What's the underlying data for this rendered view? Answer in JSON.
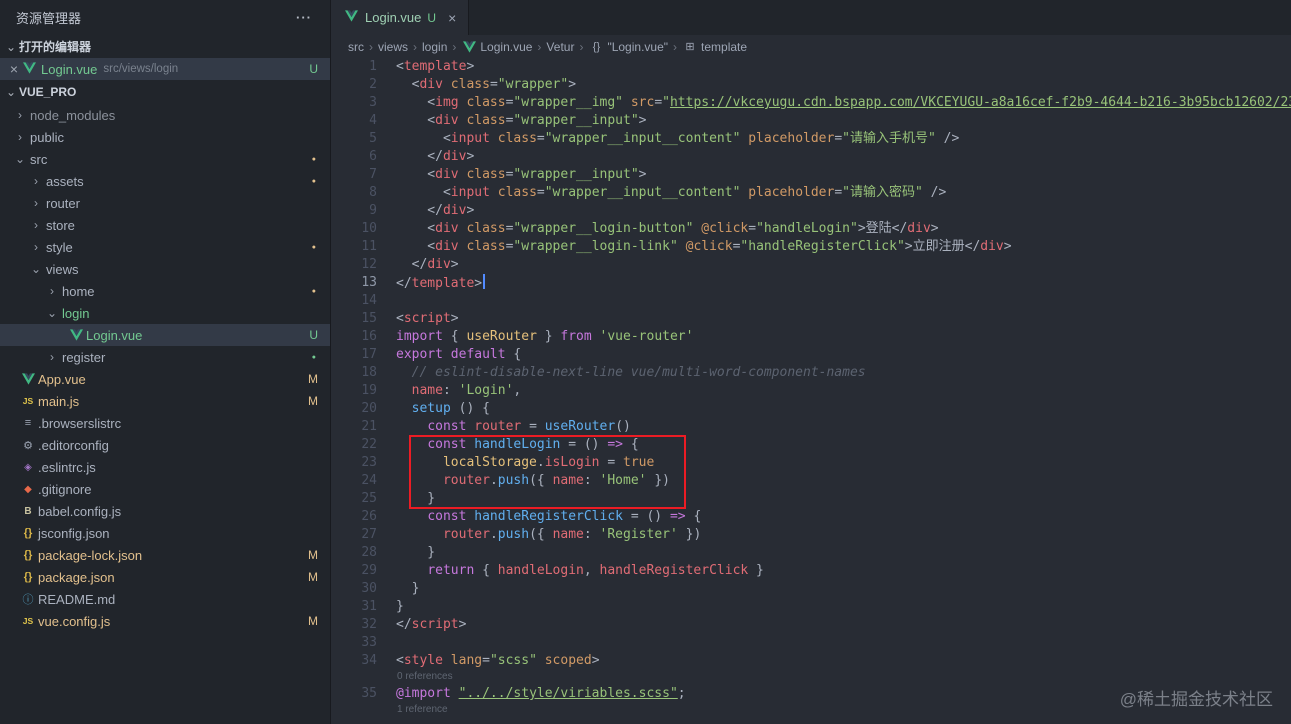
{
  "icons": {
    "ellipsis": "···",
    "chev_open": "⌄",
    "chev_closed": "›",
    "close": "×",
    "vue": "vue-logo",
    "js": "JS",
    "braces": "{}",
    "gear": "⚙",
    "list": "≡",
    "eslint": "◈",
    "git": "◆",
    "babel": "B",
    "info": "ⓘ",
    "symbol": "⊞",
    "dot": "●"
  },
  "colors": {
    "git_untracked": "#73c991",
    "git_modified": "#e2c08d",
    "vue_green": "#41b883",
    "annotation_red": "#ec1c24",
    "string_green": "#98c379",
    "keyword_purple": "#c678dd",
    "tag_red": "#e06c75",
    "attr_orange": "#d19a66",
    "func_blue": "#61afef"
  },
  "sidebar": {
    "title": "资源管理器",
    "open_editors": {
      "label": "打开的编辑器",
      "item": {
        "close": "×",
        "name": "Login.vue",
        "path": "src/views/login",
        "badge": "U"
      }
    },
    "project": {
      "label": "VUE_PRO",
      "tree": [
        {
          "label": "node_modules",
          "kind": "folder",
          "level": 0,
          "dim": true
        },
        {
          "label": "public",
          "kind": "folder",
          "level": 0
        },
        {
          "label": "src",
          "kind": "folder",
          "level": 0,
          "expanded": true,
          "dot": "gold"
        },
        {
          "label": "assets",
          "kind": "folder",
          "level": 1,
          "dot": "gold"
        },
        {
          "label": "router",
          "kind": "folder",
          "level": 1
        },
        {
          "label": "store",
          "kind": "folder",
          "level": 1
        },
        {
          "label": "style",
          "kind": "folder",
          "level": 1,
          "dot": "gold"
        },
        {
          "label": "views",
          "kind": "folder",
          "level": 1,
          "expanded": true
        },
        {
          "label": "home",
          "kind": "folder",
          "level": 2,
          "dot": "gold"
        },
        {
          "label": "login",
          "kind": "folder",
          "level": 2,
          "expanded": true,
          "color": "green"
        },
        {
          "label": "Login.vue",
          "kind": "file",
          "icon": "vue",
          "level": 3,
          "badge": "U",
          "color": "green",
          "selected": true
        },
        {
          "label": "register",
          "kind": "folder",
          "level": 2,
          "dot": "green"
        },
        {
          "label": "App.vue",
          "kind": "file",
          "icon": "vue",
          "level": 0,
          "badge": "M",
          "color": "gold"
        },
        {
          "label": "main.js",
          "kind": "file",
          "icon": "js",
          "level": 0,
          "badge": "M",
          "color": "gold"
        },
        {
          "label": ".browserslistrc",
          "kind": "file",
          "icon": "list",
          "level": 0
        },
        {
          "label": ".editorconfig",
          "kind": "file",
          "icon": "gear",
          "level": 0
        },
        {
          "label": ".eslintrc.js",
          "kind": "file",
          "icon": "eslint",
          "level": 0
        },
        {
          "label": ".gitignore",
          "kind": "file",
          "icon": "git",
          "level": 0
        },
        {
          "label": "babel.config.js",
          "kind": "file",
          "icon": "babel",
          "level": 0
        },
        {
          "label": "jsconfig.json",
          "kind": "file",
          "icon": "braces",
          "level": 0
        },
        {
          "label": "package-lock.json",
          "kind": "file",
          "icon": "braces",
          "level": 0,
          "badge": "M",
          "color": "gold"
        },
        {
          "label": "package.json",
          "kind": "file",
          "icon": "braces",
          "level": 0,
          "badge": "M",
          "color": "gold"
        },
        {
          "label": "README.md",
          "kind": "file",
          "icon": "info",
          "level": 0
        },
        {
          "label": "vue.config.js",
          "kind": "file",
          "icon": "js",
          "level": 0,
          "badge": "M",
          "color": "gold"
        }
      ]
    }
  },
  "editor": {
    "tab": {
      "name": "Login.vue",
      "badge": "U",
      "close": "×"
    },
    "breadcrumb": {
      "separator": "›",
      "items": [
        {
          "label": "src"
        },
        {
          "label": "views"
        },
        {
          "label": "login"
        },
        {
          "label": "Login.vue",
          "icon": "vue"
        },
        {
          "label": "Vetur"
        },
        {
          "label": "\"Login.vue\"",
          "icon": "braces"
        },
        {
          "label": "template",
          "icon": "symbol"
        }
      ]
    },
    "annotation": {
      "highlighted_lines": "22-25",
      "color": "#ec1c24"
    },
    "watermark": "@稀土掘金技术社区",
    "lines": [
      {
        "n": 1,
        "t": [
          [
            "p",
            "<"
          ],
          [
            "t",
            "template"
          ],
          [
            "p",
            ">"
          ]
        ]
      },
      {
        "n": 2,
        "t": [
          [
            "p",
            "  <"
          ],
          [
            "t",
            "div"
          ],
          [
            "p",
            " "
          ],
          [
            "a",
            "class"
          ],
          [
            "p",
            "="
          ],
          [
            "s",
            "\"wrapper\""
          ],
          [
            "p",
            ">"
          ]
        ]
      },
      {
        "n": 3,
        "t": [
          [
            "p",
            "    <"
          ],
          [
            "t",
            "img"
          ],
          [
            "p",
            " "
          ],
          [
            "a",
            "class"
          ],
          [
            "p",
            "="
          ],
          [
            "s",
            "\"wrapper__img\""
          ],
          [
            "p",
            " "
          ],
          [
            "a",
            "src"
          ],
          [
            "p",
            "="
          ],
          [
            "s",
            "\""
          ],
          [
            "u",
            "https://vkceyugu.cdn.bspapp.com/VKCEYUGU-a8a16cef-f2b9-4644-b216-3b95bcb12602/236a3cf5-e6"
          ]
        ]
      },
      {
        "n": 4,
        "t": [
          [
            "p",
            "    <"
          ],
          [
            "t",
            "div"
          ],
          [
            "p",
            " "
          ],
          [
            "a",
            "class"
          ],
          [
            "p",
            "="
          ],
          [
            "s",
            "\"wrapper__input\""
          ],
          [
            "p",
            ">"
          ]
        ]
      },
      {
        "n": 5,
        "t": [
          [
            "p",
            "      <"
          ],
          [
            "t",
            "input"
          ],
          [
            "p",
            " "
          ],
          [
            "a",
            "class"
          ],
          [
            "p",
            "="
          ],
          [
            "s",
            "\"wrapper__input__content\""
          ],
          [
            "p",
            " "
          ],
          [
            "a",
            "placeholder"
          ],
          [
            "p",
            "="
          ],
          [
            "s",
            "\"请输入手机号\""
          ],
          [
            "p",
            " />"
          ]
        ]
      },
      {
        "n": 6,
        "t": [
          [
            "p",
            "    </"
          ],
          [
            "t",
            "div"
          ],
          [
            "p",
            ">"
          ]
        ]
      },
      {
        "n": 7,
        "t": [
          [
            "p",
            "    <"
          ],
          [
            "t",
            "div"
          ],
          [
            "p",
            " "
          ],
          [
            "a",
            "class"
          ],
          [
            "p",
            "="
          ],
          [
            "s",
            "\"wrapper__input\""
          ],
          [
            "p",
            ">"
          ]
        ]
      },
      {
        "n": 8,
        "t": [
          [
            "p",
            "      <"
          ],
          [
            "t",
            "input"
          ],
          [
            "p",
            " "
          ],
          [
            "a",
            "class"
          ],
          [
            "p",
            "="
          ],
          [
            "s",
            "\"wrapper__input__content\""
          ],
          [
            "p",
            " "
          ],
          [
            "a",
            "placeholder"
          ],
          [
            "p",
            "="
          ],
          [
            "s",
            "\"请输入密码\""
          ],
          [
            "p",
            " />"
          ]
        ]
      },
      {
        "n": 9,
        "t": [
          [
            "p",
            "    </"
          ],
          [
            "t",
            "div"
          ],
          [
            "p",
            ">"
          ]
        ]
      },
      {
        "n": 10,
        "t": [
          [
            "p",
            "    <"
          ],
          [
            "t",
            "div"
          ],
          [
            "p",
            " "
          ],
          [
            "a",
            "class"
          ],
          [
            "p",
            "="
          ],
          [
            "s",
            "\"wrapper__login-button\""
          ],
          [
            "p",
            " "
          ],
          [
            "a",
            "@click"
          ],
          [
            "p",
            "="
          ],
          [
            "s",
            "\"handleLogin\""
          ],
          [
            "p",
            ">登陆</"
          ],
          [
            "t",
            "div"
          ],
          [
            "p",
            ">"
          ]
        ]
      },
      {
        "n": 11,
        "t": [
          [
            "p",
            "    <"
          ],
          [
            "t",
            "div"
          ],
          [
            "p",
            " "
          ],
          [
            "a",
            "class"
          ],
          [
            "p",
            "="
          ],
          [
            "s",
            "\"wrapper__login-link\""
          ],
          [
            "p",
            " "
          ],
          [
            "a",
            "@click"
          ],
          [
            "p",
            "="
          ],
          [
            "s",
            "\"handleRegisterClick\""
          ],
          [
            "p",
            ">立即注册</"
          ],
          [
            "t",
            "div"
          ],
          [
            "p",
            ">"
          ]
        ]
      },
      {
        "n": 12,
        "t": [
          [
            "p",
            "  </"
          ],
          [
            "t",
            "div"
          ],
          [
            "p",
            ">"
          ]
        ]
      },
      {
        "n": 13,
        "cursor": true,
        "t": [
          [
            "p",
            "</"
          ],
          [
            "t",
            "template"
          ],
          [
            "p",
            ">"
          ]
        ]
      },
      {
        "n": 14,
        "t": []
      },
      {
        "n": 15,
        "t": [
          [
            "p",
            "<"
          ],
          [
            "t",
            "script"
          ],
          [
            "p",
            ">"
          ]
        ]
      },
      {
        "n": 16,
        "t": [
          [
            "k",
            "import"
          ],
          [
            "p",
            " { "
          ],
          [
            "y",
            "useRouter"
          ],
          [
            "p",
            " } "
          ],
          [
            "k",
            "from"
          ],
          [
            "p",
            " "
          ],
          [
            "s",
            "'vue-router'"
          ]
        ]
      },
      {
        "n": 17,
        "t": [
          [
            "k",
            "export"
          ],
          [
            "p",
            " "
          ],
          [
            "k",
            "default"
          ],
          [
            "p",
            " {"
          ]
        ]
      },
      {
        "n": 18,
        "t": [
          [
            "c",
            "  // eslint-disable-next-line vue/multi-word-component-names"
          ]
        ]
      },
      {
        "n": 19,
        "t": [
          [
            "p",
            "  "
          ],
          [
            "r",
            "name"
          ],
          [
            "p",
            ": "
          ],
          [
            "s",
            "'Login'"
          ],
          [
            "p",
            ","
          ]
        ]
      },
      {
        "n": 20,
        "t": [
          [
            "p",
            "  "
          ],
          [
            "f",
            "setup"
          ],
          [
            "p",
            " () {"
          ]
        ]
      },
      {
        "n": 21,
        "t": [
          [
            "p",
            "    "
          ],
          [
            "k",
            "const"
          ],
          [
            "p",
            " "
          ],
          [
            "r",
            "router"
          ],
          [
            "p",
            " = "
          ],
          [
            "f",
            "useRouter"
          ],
          [
            "p",
            "()"
          ]
        ]
      },
      {
        "n": 22,
        "t": [
          [
            "p",
            "    "
          ],
          [
            "k",
            "const"
          ],
          [
            "p",
            " "
          ],
          [
            "f",
            "handleLogin"
          ],
          [
            "p",
            " = () "
          ],
          [
            "k",
            "=>"
          ],
          [
            "p",
            " {"
          ]
        ]
      },
      {
        "n": 23,
        "t": [
          [
            "p",
            "      "
          ],
          [
            "y",
            "localStorage"
          ],
          [
            "p",
            "."
          ],
          [
            "r",
            "isLogin"
          ],
          [
            "p",
            " = "
          ],
          [
            "o",
            "true"
          ]
        ]
      },
      {
        "n": 24,
        "t": [
          [
            "p",
            "      "
          ],
          [
            "r",
            "router"
          ],
          [
            "p",
            "."
          ],
          [
            "f",
            "push"
          ],
          [
            "p",
            "({ "
          ],
          [
            "r",
            "name"
          ],
          [
            "p",
            ": "
          ],
          [
            "s",
            "'Home'"
          ],
          [
            "p",
            " })"
          ]
        ]
      },
      {
        "n": 25,
        "t": [
          [
            "p",
            "    }"
          ]
        ]
      },
      {
        "n": 26,
        "t": [
          [
            "p",
            "    "
          ],
          [
            "k",
            "const"
          ],
          [
            "p",
            " "
          ],
          [
            "f",
            "handleRegisterClick"
          ],
          [
            "p",
            " = () "
          ],
          [
            "k",
            "=>"
          ],
          [
            "p",
            " {"
          ]
        ]
      },
      {
        "n": 27,
        "t": [
          [
            "p",
            "      "
          ],
          [
            "r",
            "router"
          ],
          [
            "p",
            "."
          ],
          [
            "f",
            "push"
          ],
          [
            "p",
            "({ "
          ],
          [
            "r",
            "name"
          ],
          [
            "p",
            ": "
          ],
          [
            "s",
            "'Register'"
          ],
          [
            "p",
            " })"
          ]
        ]
      },
      {
        "n": 28,
        "t": [
          [
            "p",
            "    }"
          ]
        ]
      },
      {
        "n": 29,
        "t": [
          [
            "p",
            "    "
          ],
          [
            "k",
            "return"
          ],
          [
            "p",
            " { "
          ],
          [
            "r",
            "handleLogin"
          ],
          [
            "p",
            ", "
          ],
          [
            "r",
            "handleRegisterClick"
          ],
          [
            "p",
            " }"
          ]
        ]
      },
      {
        "n": 30,
        "t": [
          [
            "p",
            "  }"
          ]
        ]
      },
      {
        "n": 31,
        "t": [
          [
            "p",
            "}"
          ]
        ]
      },
      {
        "n": 32,
        "t": [
          [
            "p",
            "</"
          ],
          [
            "t",
            "script"
          ],
          [
            "p",
            ">"
          ]
        ]
      },
      {
        "n": 33,
        "t": []
      },
      {
        "n": 34,
        "t": [
          [
            "p",
            "<"
          ],
          [
            "t",
            "style"
          ],
          [
            "p",
            " "
          ],
          [
            "a",
            "lang"
          ],
          [
            "p",
            "="
          ],
          [
            "s",
            "\"scss\""
          ],
          [
            "p",
            " "
          ],
          [
            "a",
            "scoped"
          ],
          [
            "p",
            ">"
          ]
        ]
      },
      {
        "lens": "0 references"
      },
      {
        "n": 35,
        "t": [
          [
            "k",
            "@import"
          ],
          [
            "p",
            " "
          ],
          [
            "u",
            "\"../../style/viriables.scss\""
          ],
          [
            "p",
            ";"
          ]
        ]
      },
      {
        "lens": "1 reference"
      }
    ]
  }
}
